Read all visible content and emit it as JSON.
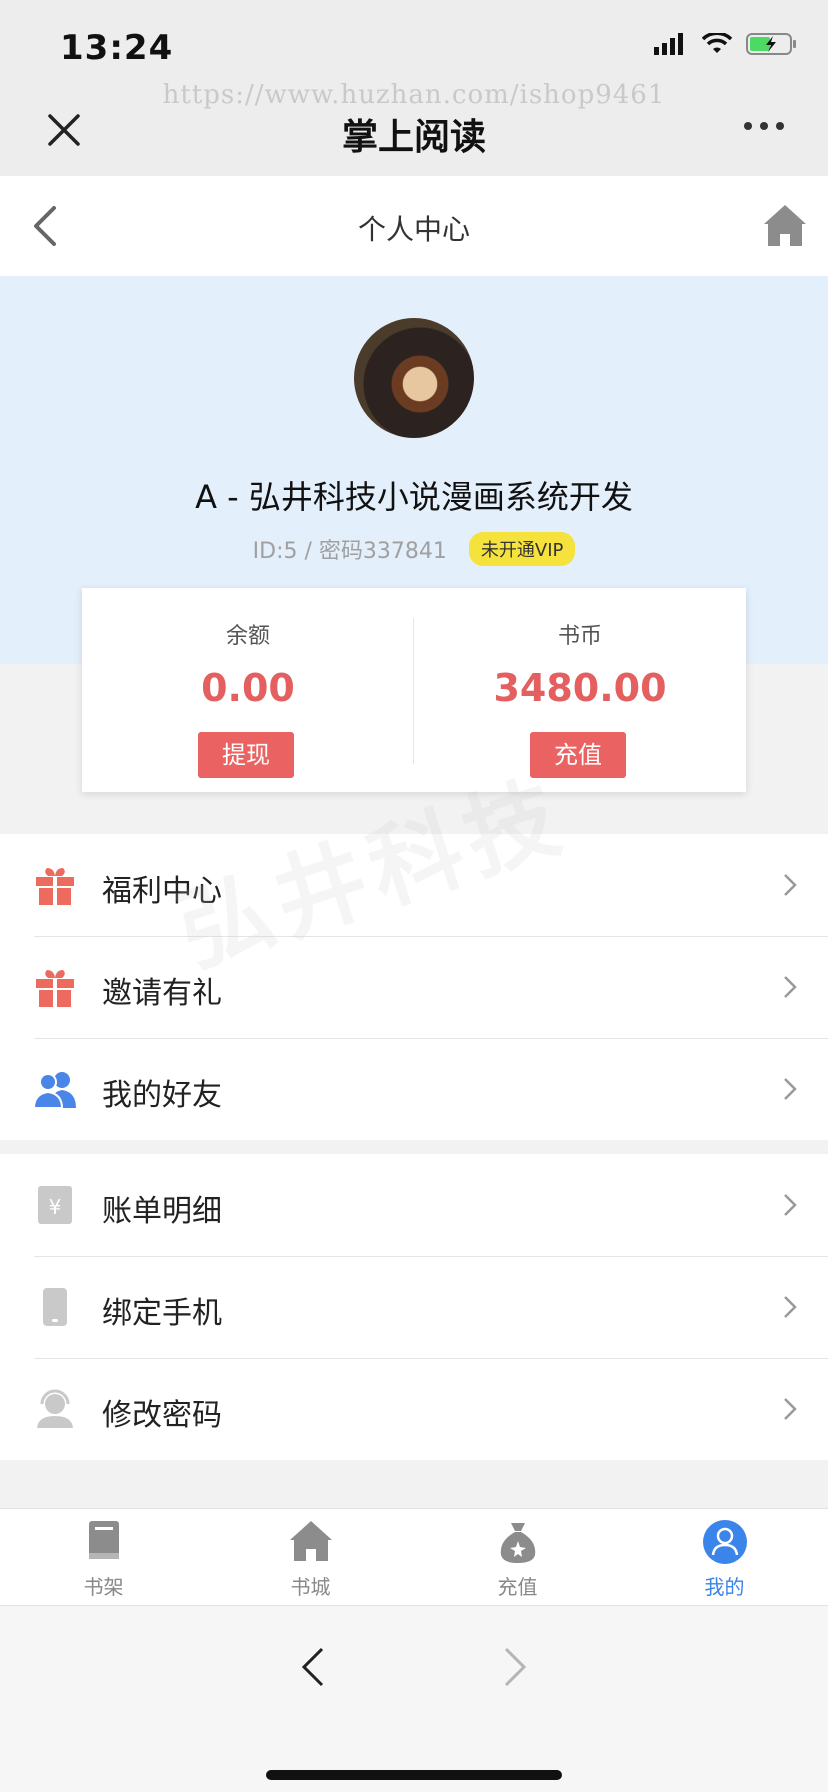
{
  "status": {
    "time": "13:24"
  },
  "wechat": {
    "url": "https://www.huzhan.com/ishop9461",
    "title": "掌上阅读"
  },
  "header": {
    "title": "个人中心"
  },
  "profile": {
    "name": "A - 弘井科技小说漫画系统开发",
    "id_text": "ID:5 / 密码337841",
    "vip_badge": "未开通VIP"
  },
  "wallet": {
    "balance_label": "余额",
    "balance_value": "0.00",
    "withdraw_label": "提现",
    "coins_label": "书币",
    "coins_value": "3480.00",
    "recharge_label": "充值"
  },
  "watermark": "弘井科技",
  "menu_group1": [
    {
      "label": "福利中心",
      "icon": "gift-icon"
    },
    {
      "label": "邀请有礼",
      "icon": "gift-icon"
    },
    {
      "label": "我的好友",
      "icon": "friends-icon"
    }
  ],
  "menu_group2": [
    {
      "label": "账单明细",
      "icon": "bill-icon"
    },
    {
      "label": "绑定手机",
      "icon": "phone-icon"
    },
    {
      "label": "修改密码",
      "icon": "support-icon"
    }
  ],
  "tabs": [
    {
      "label": "书架",
      "icon": "bookshelf-icon"
    },
    {
      "label": "书城",
      "icon": "store-icon"
    },
    {
      "label": "充值",
      "icon": "money-bag-icon"
    },
    {
      "label": "我的",
      "icon": "user-icon",
      "active": true
    }
  ],
  "colors": {
    "accent": "#3a84ea",
    "price": "#e45f5f",
    "button": "#ea6262",
    "profile_bg": "#e3effb",
    "vip": "#f5e23c"
  }
}
